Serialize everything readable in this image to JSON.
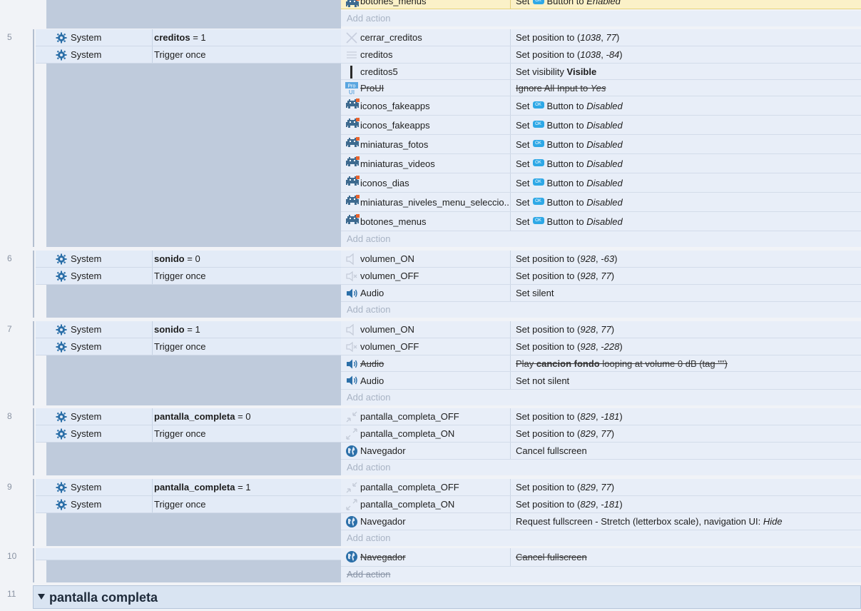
{
  "labels": {
    "add_action": "Add action",
    "set": "Set",
    "button_to": "Button to",
    "set_position_to": "Set position to",
    "set_visibility": "Set visibility",
    "trigger_once": "Trigger once",
    "system": "System",
    "btn_badge": "OK"
  },
  "top_partial": {
    "object": "botones_menus",
    "set": "Set",
    "value": "Enabled",
    "button_to": "Button to"
  },
  "events": [
    {
      "number": "5",
      "conditions": [
        {
          "object": "System",
          "var": "creditos",
          "op": "= 1"
        },
        {
          "object": "System",
          "text": "Trigger once"
        }
      ],
      "actions": [
        {
          "object": "cerrar_creditos",
          "icon": "close-x-icon",
          "kind": "pos",
          "x": "1038",
          "y": "77"
        },
        {
          "object": "creditos",
          "icon": "lines-icon",
          "kind": "pos",
          "x": "1038",
          "y": "-84"
        },
        {
          "object": "creditos5",
          "icon": "bar-icon",
          "kind": "vis",
          "value": "Visible"
        },
        {
          "object": "ProUI",
          "icon": "proui-icon",
          "kind": "text",
          "disabled": true,
          "text_before": "Ignore All Input to ",
          "text_italic": "Yes"
        },
        {
          "object": "iconos_fakeapps",
          "icon": "invader-icon",
          "kind": "btn",
          "value": "Disabled"
        },
        {
          "object": "iconos_fakeapps",
          "icon": "invader-icon",
          "kind": "btn",
          "value": "Disabled"
        },
        {
          "object": "miniaturas_fotos",
          "icon": "invader-icon",
          "kind": "btn",
          "value": "Disabled"
        },
        {
          "object": "miniaturas_videos",
          "icon": "invader-icon",
          "kind": "btn",
          "value": "Disabled"
        },
        {
          "object": "iconos_dias",
          "icon": "invader-icon",
          "kind": "btn",
          "value": "Disabled"
        },
        {
          "object": "miniaturas_niveles_menu_seleccio...",
          "icon": "invader-icon",
          "kind": "btn",
          "value": "Disabled"
        },
        {
          "object": "botones_menus",
          "icon": "invader-icon",
          "kind": "btn",
          "value": "Disabled"
        }
      ]
    },
    {
      "number": "6",
      "conditions": [
        {
          "object": "System",
          "var": "sonido",
          "op": "= 0"
        },
        {
          "object": "System",
          "text": "Trigger once"
        }
      ],
      "actions": [
        {
          "object": "volumen_ON",
          "icon": "speaker-outline-icon",
          "kind": "pos",
          "x": "928",
          "y": "-63"
        },
        {
          "object": "volumen_OFF",
          "icon": "speaker-mute-icon",
          "kind": "pos",
          "x": "928",
          "y": "77"
        },
        {
          "object": "Audio",
          "icon": "speaker-icon",
          "kind": "plain",
          "text": "Set silent"
        }
      ]
    },
    {
      "number": "7",
      "conditions": [
        {
          "object": "System",
          "var": "sonido",
          "op": "= 1"
        },
        {
          "object": "System",
          "text": "Trigger once"
        }
      ],
      "actions": [
        {
          "object": "volumen_ON",
          "icon": "speaker-outline-icon",
          "kind": "pos",
          "x": "928",
          "y": "77"
        },
        {
          "object": "volumen_OFF",
          "icon": "speaker-mute-icon",
          "kind": "pos",
          "x": "928",
          "y": "-228"
        },
        {
          "object": "Audio",
          "icon": "speaker-icon",
          "kind": "play",
          "disabled": true,
          "pre": "Play ",
          "bold": "cancion fondo",
          "post": " looping at volume 0 dB (tag \"\")"
        },
        {
          "object": "Audio",
          "icon": "speaker-icon",
          "kind": "plain",
          "text": "Set not silent"
        }
      ]
    },
    {
      "number": "8",
      "conditions": [
        {
          "object": "System",
          "var": "pantalla_completa",
          "op": "= 0"
        },
        {
          "object": "System",
          "text": "Trigger once"
        }
      ],
      "actions": [
        {
          "object": "pantalla_completa_OFF",
          "icon": "shrink-icon",
          "kind": "pos",
          "x": "829",
          "y": "-181"
        },
        {
          "object": "pantalla_completa_ON",
          "icon": "expand-icon",
          "kind": "pos",
          "x": "829",
          "y": "77"
        },
        {
          "object": "Navegador",
          "icon": "globe-icon",
          "kind": "plain",
          "text": "Cancel fullscreen"
        }
      ]
    },
    {
      "number": "9",
      "conditions": [
        {
          "object": "System",
          "var": "pantalla_completa",
          "op": "= 1"
        },
        {
          "object": "System",
          "text": "Trigger once"
        }
      ],
      "actions": [
        {
          "object": "pantalla_completa_OFF",
          "icon": "shrink-icon",
          "kind": "pos",
          "x": "829",
          "y": "77"
        },
        {
          "object": "pantalla_completa_ON",
          "icon": "expand-icon",
          "kind": "pos",
          "x": "829",
          "y": "-181"
        },
        {
          "object": "Navegador",
          "icon": "globe-icon",
          "kind": "req",
          "pre": "Request fullscreen - Stretch (letterbox scale), navigation UI: ",
          "italic": "Hide"
        }
      ]
    },
    {
      "number": "10",
      "conditions": [],
      "disabled_add": true,
      "actions": [
        {
          "object": "Navegador",
          "icon": "globe-icon",
          "kind": "plain",
          "disabled": true,
          "text": "Cancel fullscreen"
        }
      ]
    }
  ],
  "group": {
    "number": "11",
    "title": "pantalla completa"
  }
}
